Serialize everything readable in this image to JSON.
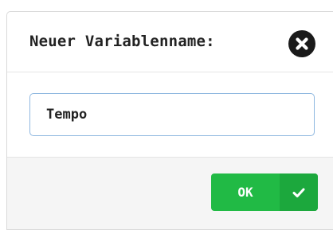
{
  "dialog": {
    "title": "Neuer Variablenname:",
    "close_icon": "close-circle-icon"
  },
  "input": {
    "value": "Tempo",
    "focus_color": "#8fb8e0"
  },
  "footer": {
    "ok_label": "OK",
    "ok_icon": "checkmark-icon",
    "ok_color": "#21ba45"
  }
}
